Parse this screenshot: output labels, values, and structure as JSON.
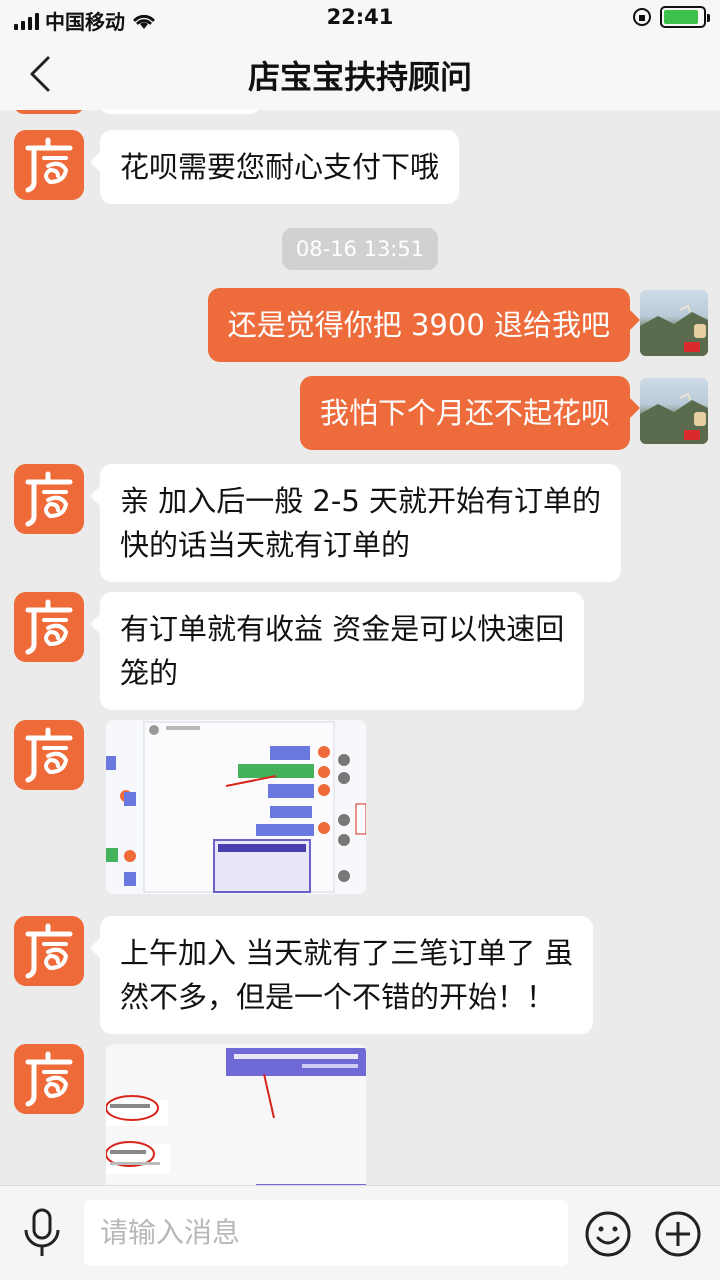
{
  "status_bar": {
    "carrier": "中国移动",
    "time": "22:41"
  },
  "header": {
    "title": "店宝宝扶持顾问"
  },
  "messages": [
    {
      "from": "agent",
      "type": "text",
      "lines": [
        "花呗需要您耐心支付下哦"
      ]
    },
    {
      "type": "timestamp",
      "text": "08-16 13:51"
    },
    {
      "from": "me",
      "type": "text",
      "lines": [
        "还是觉得你把 3900 退给我吧"
      ]
    },
    {
      "from": "me",
      "type": "text",
      "lines": [
        "我怕下个月还不起花呗"
      ]
    },
    {
      "from": "agent",
      "type": "text",
      "lines": [
        "亲 加入后一般 2-5 天就开始有订单的",
        "快的话当天就有订单的"
      ]
    },
    {
      "from": "agent",
      "type": "text",
      "lines": [
        "有订单就有收益 资金是可以快速回",
        "笼的"
      ]
    },
    {
      "from": "agent",
      "type": "image",
      "description": "screenshot-of-chat"
    },
    {
      "from": "agent",
      "type": "text",
      "lines": [
        "上午加入 当天就有了三笔订单了 虽",
        "然不多，但是一个不错的开始！！"
      ]
    },
    {
      "from": "agent",
      "type": "image",
      "description": "screenshot-of-chat"
    }
  ],
  "input": {
    "placeholder": "请输入消息"
  },
  "colors": {
    "brand_orange": "#ef6a39",
    "my_bubble": "#ee6b3c",
    "background": "#ebebeb"
  },
  "icons": [
    "back-chevron-icon",
    "mic-icon",
    "emoji-icon",
    "plus-icon",
    "wifi-icon",
    "signal-icon",
    "battery-icon",
    "store-logo-icon"
  ]
}
